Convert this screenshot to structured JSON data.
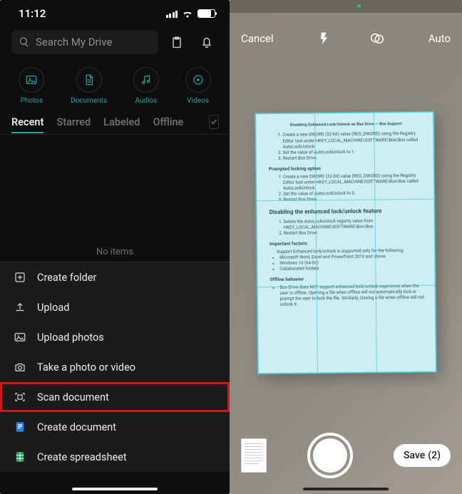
{
  "statusbar": {
    "time": "11:12"
  },
  "search": {
    "placeholder": "Search My Drive"
  },
  "categories": [
    {
      "id": "photos",
      "label": "Photos"
    },
    {
      "id": "documents",
      "label": "Documents"
    },
    {
      "id": "audios",
      "label": "Audios"
    },
    {
      "id": "videos",
      "label": "Videos"
    }
  ],
  "tabs": [
    {
      "id": "recent",
      "label": "Recent",
      "active": true
    },
    {
      "id": "starred",
      "label": "Starred",
      "active": false
    },
    {
      "id": "labeled",
      "label": "Labeled",
      "active": false
    },
    {
      "id": "offline",
      "label": "Offline",
      "active": false
    }
  ],
  "empty_label": "No items",
  "sheet_items": [
    {
      "id": "create-folder",
      "label": "Create folder",
      "icon": "folder-plus-icon"
    },
    {
      "id": "upload",
      "label": "Upload",
      "icon": "upload-icon"
    },
    {
      "id": "upload-photos",
      "label": "Upload photos",
      "icon": "image-upload-icon"
    },
    {
      "id": "take-photo",
      "label": "Take a photo or video",
      "icon": "camera-icon"
    },
    {
      "id": "scan-document",
      "label": "Scan document",
      "icon": "scan-icon",
      "highlight": true
    },
    {
      "id": "create-document",
      "label": "Create document",
      "icon": "doc-icon",
      "icon_color": "#2b7de9"
    },
    {
      "id": "create-spreadsheet",
      "label": "Create spreadsheet",
      "icon": "sheet-icon",
      "icon_color": "#20a464"
    }
  ],
  "scanner": {
    "cancel": "Cancel",
    "mode": "Auto",
    "save_label": "Save",
    "save_count": 2,
    "flash_icon": "flash-icon",
    "filter_icon": "filter-icon",
    "document": {
      "title": "Disabling Enhanced Lock/Unlock on Box Drive — Box Support",
      "heading_main": "Disabling the enhanced lock/unlock feature",
      "heading_prompted": "Prompted locking option",
      "heading_factors": "Important factors:",
      "heading_offline": "Offline behavior",
      "intro_steps": [
        "Create a new DWORD (32-bit) value (REG_DWORD) using the Registry Editor tool under HKEY_LOCAL_MACHINE\\SOFTWARE\\Box\\Box called AutoLockUnlock.",
        "Set the value of AutoLockUnlock to 1.",
        "Restart Box Drive."
      ],
      "prompted_steps": [
        "Create a new DWORD (32-bit) value (REG_DWORD) using the Registry Editor tool under HKEY_LOCAL_MACHINE\\SOFTWARE\\Box\\Box called AutoLockUnlock.",
        "Set the value of AutoLockUnlock to 0.",
        "Restart Box Drive."
      ],
      "disable_steps": [
        "Delete the AutoLockUnlock registry value from HKEY_LOCAL_MACHINE\\SOFTWARE\\Box\\Box.",
        "Restart Box Drive."
      ],
      "support_line": "Support  Enhanced lock/unlock is supported only for the following:",
      "support_bullets": [
        "Microsoft Word, Excel and PowerPoint 2010 and above.",
        "Windows 10 (64-bit)",
        "Collaborated folders"
      ],
      "offline_bullet": "Box Drive does NOT support enhanced lock/unlock experience when the user is offline. Opening a file when offline will not automatically lock or prompt the user to lock the file. Similarly, closing a file when offline will not unlock it."
    }
  }
}
